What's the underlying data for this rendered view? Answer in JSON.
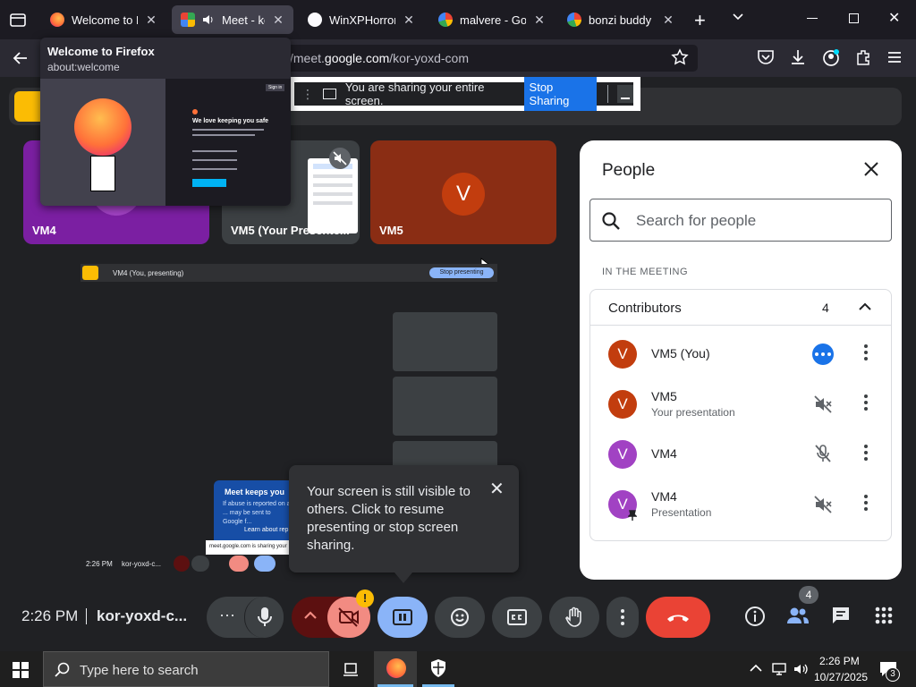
{
  "tabs": [
    {
      "title": "Welcome to Fi",
      "active": false
    },
    {
      "title": "Meet - kor-y",
      "active": true
    },
    {
      "title": "WinXPHorrorEdi",
      "active": false
    },
    {
      "title": "malvere - Googl",
      "active": false
    },
    {
      "title": "bonzi buddy do",
      "active": false
    }
  ],
  "tab_preview": {
    "title": "Welcome to Firefox",
    "url": "about:welcome",
    "thumb_heading": "We love keeping you safe",
    "thumb_signin": "Sign in"
  },
  "urlbar": {
    "prefix": "/meet.",
    "domain": "google.com",
    "path": "/kor-yoxd-com"
  },
  "share_banner": {
    "text": "You are sharing your entire screen.",
    "button": "Stop Sharing"
  },
  "tiles": [
    {
      "name": "VM4",
      "color": "#7b1fa2"
    },
    {
      "name": "VM5 (Your Presente...",
      "color": "#3c4043"
    },
    {
      "name": "VM5",
      "color": "#8a2d14",
      "initial": "V",
      "avatar_color": "#c23d0e"
    }
  ],
  "mirror": {
    "bar_text": "VM4 (You, presenting)",
    "bar_button": "Stop presenting",
    "time": "2:26 PM",
    "code": "kor-yoxd-c...",
    "card_title": "Meet keeps you",
    "card_body": "If abuse is reported on a ... may be sent to Google f...",
    "card_link": "Learn about rep",
    "url_snip": "meet.google.com is sharing your"
  },
  "popup": {
    "text": "Your screen is still visible to others. Click to resume presenting or stop screen sharing."
  },
  "people_panel": {
    "title": "People",
    "search_placeholder": "Search for people",
    "section_label": "IN THE MEETING",
    "group": {
      "label": "Contributors",
      "count": "4"
    },
    "members": [
      {
        "name": "VM5 (You)",
        "sub": "",
        "initial": "V",
        "color": "#c23d0e",
        "status_icon": "more-horiz-icon"
      },
      {
        "name": "VM5",
        "sub": "Your presentation",
        "initial": "V",
        "color": "#c23d0e",
        "status_icon": "volume-off-icon"
      },
      {
        "name": "VM4",
        "sub": "",
        "initial": "V",
        "color": "#a142c3",
        "status_icon": "mic-off-icon"
      },
      {
        "name": "VM4",
        "sub": "Presentation",
        "initial": "V",
        "color": "#a142c3",
        "status_icon": "volume-off-icon"
      }
    ]
  },
  "bottom": {
    "time": "2:26 PM",
    "code": "kor-yoxd-c...",
    "people_badge": "4",
    "camera_warning": "!"
  },
  "taskbar": {
    "search_placeholder": "Type here to search",
    "time": "2:26 PM",
    "date": "10/27/2025",
    "notif_count": "3"
  }
}
